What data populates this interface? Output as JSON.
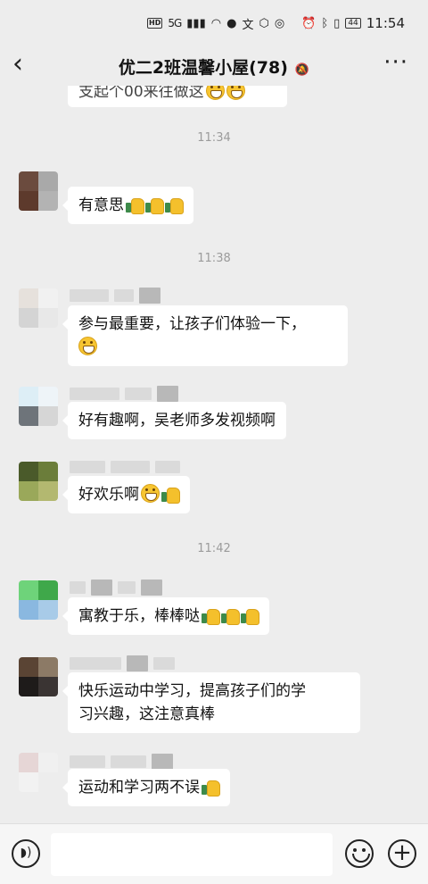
{
  "status_bar": {
    "hd": "HD",
    "network": "5G",
    "signal_icon": "signal-bars-icon",
    "time": "11:54",
    "battery": "44"
  },
  "header": {
    "back_icon": "back-arrow-icon",
    "title": "优二2班温馨小屋(78)",
    "mute_icon": "muted-bell-icon",
    "more_icon": "more-dots-icon"
  },
  "chat": {
    "partial_message": "支起个00来往做这",
    "times": [
      "11:34",
      "11:38",
      "11:42"
    ],
    "messages": [
      {
        "text": "有意思",
        "emojis": [
          "thumbs-up",
          "thumbs-up",
          "thumbs-up"
        ],
        "avatar_colors": [
          "#6b4b3e",
          "#a9a9a9",
          "#5d3a2c",
          "#b3b3b3"
        ]
      },
      {
        "line1": "参与最重要，让孩子们体验一下，",
        "emojis": [
          "grin"
        ],
        "avatar_colors": [
          "#e6e1dc",
          "#f1f1f1",
          "#d4d4d4",
          "#e8e8e8"
        ]
      },
      {
        "text": "好有趣啊，吴老师多发视频啊",
        "avatar_colors": [
          "#ddeef6",
          "#eef4f8",
          "#6e747a",
          "#d6d6d6"
        ]
      },
      {
        "text": "好欢乐啊",
        "emojis": [
          "grin",
          "thumbs-up"
        ],
        "avatar_colors": [
          "#4a5a2a",
          "#6b7d3a",
          "#9aa85a",
          "#b3b870"
        ]
      },
      {
        "text": "寓教于乐，棒棒哒",
        "emojis": [
          "thumbs-up",
          "thumbs-up",
          "thumbs-up"
        ],
        "avatar_colors": [
          "#6ed37a",
          "#3fa84a",
          "#8ab8e0",
          "#a8cbe8"
        ]
      },
      {
        "line1": "快乐运动中学习，提高孩子们的学",
        "line2": "习兴趣，这注意真棒",
        "avatar_colors": [
          "#5a4434",
          "#8c7a66",
          "#1e1b1a",
          "#3a3433"
        ]
      },
      {
        "text": "运动和学习两不误",
        "emojis": [
          "thumbs-up"
        ],
        "avatar_colors": [
          "#e6d6d6",
          "#f0f0f0",
          "#f2f2f2",
          "#ededed"
        ]
      }
    ]
  },
  "input_bar": {
    "voice_icon": "voice-icon",
    "emoji_icon": "emoji-icon",
    "plus_icon": "plus-icon"
  }
}
